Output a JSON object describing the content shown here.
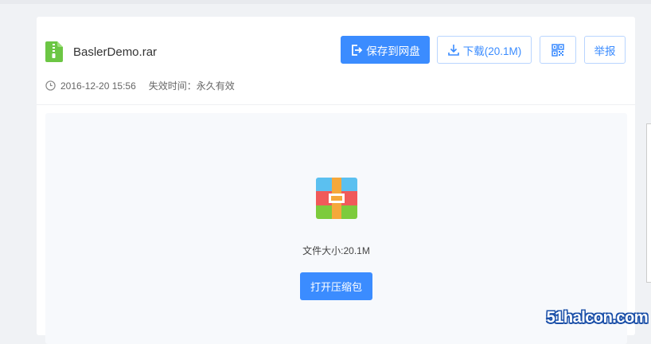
{
  "file": {
    "name": "BaslerDemo.rar",
    "date": "2016-12-20 15:56",
    "expiry": "失效时间：永久有效",
    "size_text": "文件大小:20.1M"
  },
  "toolbar": {
    "save_label": "保存到网盘",
    "download_label": "下载(20.1M)",
    "report_label": "举报"
  },
  "preview": {
    "open_label": "打开压缩包"
  },
  "watermark": "51halcon.com",
  "colors": {
    "accent": "#3b8cff",
    "file_icon": "#6cc644"
  }
}
